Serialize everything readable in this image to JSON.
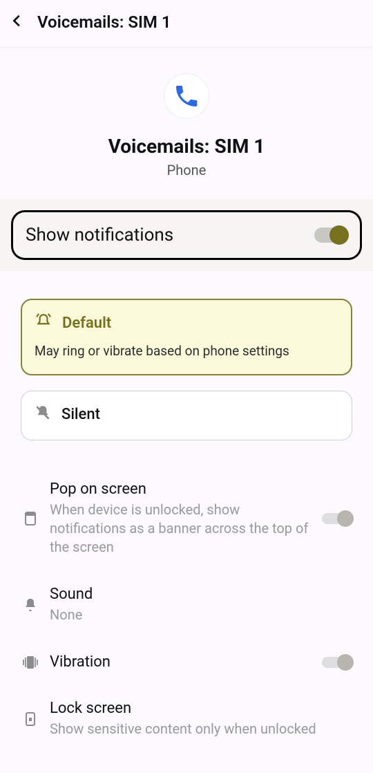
{
  "header": {
    "title": "Voicemails: SIM 1"
  },
  "hero": {
    "title": "Voicemails: SIM 1",
    "subtitle": "Phone"
  },
  "show_notifications": {
    "label": "Show notifications",
    "on": true
  },
  "alert_options": {
    "default": {
      "title": "Default",
      "desc": "May ring or vibrate based on phone settings"
    },
    "silent": {
      "title": "Silent"
    }
  },
  "settings": {
    "pop": {
      "title": "Pop on screen",
      "desc": "When device is unlocked, show notifications as a banner across the top of the screen",
      "on": false
    },
    "sound": {
      "title": "Sound",
      "value": "None"
    },
    "vibration": {
      "title": "Vibration",
      "on": false
    },
    "lock": {
      "title": "Lock screen",
      "desc": "Show sensitive content only when unlocked"
    }
  }
}
